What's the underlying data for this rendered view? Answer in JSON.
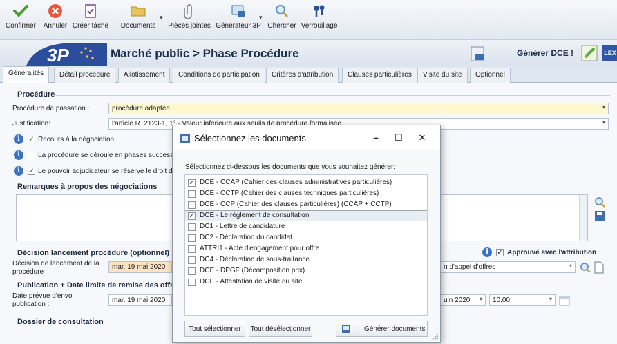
{
  "toolbar": {
    "confirm": "Confirmer",
    "cancel": "Annuler",
    "create_task": "Créer tâche",
    "documents": "Documents",
    "attachments": "Pièces jointes",
    "generator": "Générateur 3P",
    "search": "Chercher",
    "lock": "Verrouillage"
  },
  "header": {
    "logo_text": "3P",
    "title": "Marché public  >  Phase Procédure",
    "generate_dce": "Générer DCE !",
    "lex_badge": "LEX"
  },
  "tabs": [
    {
      "label": "Généralités",
      "active": true
    },
    {
      "label": "Détail procédure",
      "active": false
    },
    {
      "label": "Allotissement",
      "active": false
    },
    {
      "label": "Conditions de participation",
      "active": false
    },
    {
      "label": "Critères d'attribution",
      "active": false
    },
    {
      "label": "Clauses particulières",
      "active": false
    },
    {
      "label": "Visite du site",
      "active": false
    },
    {
      "label": "Optionnel",
      "active": false
    }
  ],
  "procedure": {
    "section_title": "Procédure",
    "passation_label": "Procédure de passation :",
    "passation_value": "procédure adaptée",
    "justification_label": "Justification:",
    "justification_value": "l'article R. 2123-1, 1° - Valeur inférieure aux seuils de procédure formalisée",
    "checks": [
      {
        "label": "Recours à la négociation",
        "checked": true
      },
      {
        "label": "La procédure se déroule en phases successives",
        "checked": false
      },
      {
        "label": "Le pouvoir adjudicateur se réserve le droit d'attribuer",
        "checked": true
      }
    ]
  },
  "remarques": {
    "section_title": "Remarques à propos des négociations"
  },
  "decision": {
    "section_title": "Décision lancement procédure (optionnel)",
    "label": "Décision de lancement de la procédure",
    "value": "mar. 19 mai 2020",
    "approved_label": "Approuvé avec l'attribution",
    "approved_checked": true,
    "right_select": "n d'appel d'offres"
  },
  "publication": {
    "section_title": "Publication + Date limite de remise des offres",
    "label": "Date prévue d'envoi publication :",
    "value": "mar. 19 mai 2020",
    "right_date": "uin 2020",
    "right_time": "10.00"
  },
  "dossier": {
    "section_title": "Dossier de consultation"
  },
  "dialog": {
    "title": "Sélectionnez les documents",
    "instruction": "Sélectionnez ci-dessous les documents que vous souhaitez générer:",
    "items": [
      {
        "label": "DCE - CCAP (Cahier des clauses administratives particulières)",
        "checked": true,
        "selected": false
      },
      {
        "label": "DCE - CCTP (Cahier des clauses techniques particulières)",
        "checked": false,
        "selected": false
      },
      {
        "label": "DCE - CCP (Cahier des clauses particulières) (CCAP + CCTP)",
        "checked": false,
        "selected": false
      },
      {
        "label": "DCE - Le règlement de consultation",
        "checked": true,
        "selected": true
      },
      {
        "label": "DC1 - Lettre de candidature",
        "checked": false,
        "selected": false
      },
      {
        "label": "DC2 - Déclaration du candidat",
        "checked": false,
        "selected": false
      },
      {
        "label": "ATTRI1 - Acte d'engagement pour offre",
        "checked": false,
        "selected": false
      },
      {
        "label": "DC4 - Déclaration de sous-traitance",
        "checked": false,
        "selected": false
      },
      {
        "label": "DCE - DPGF (Décomposition prix)",
        "checked": false,
        "selected": false
      },
      {
        "label": "DCE - Attestation de visite du site",
        "checked": false,
        "selected": false
      }
    ],
    "select_all": "Tout sélectionner",
    "deselect_all": "Tout désélectionner",
    "generate": "Générer documents"
  },
  "colors": {
    "accent_blue": "#2f56a8",
    "field_yellow": "#fdf8cf",
    "field_orange": "#fde3c4"
  }
}
